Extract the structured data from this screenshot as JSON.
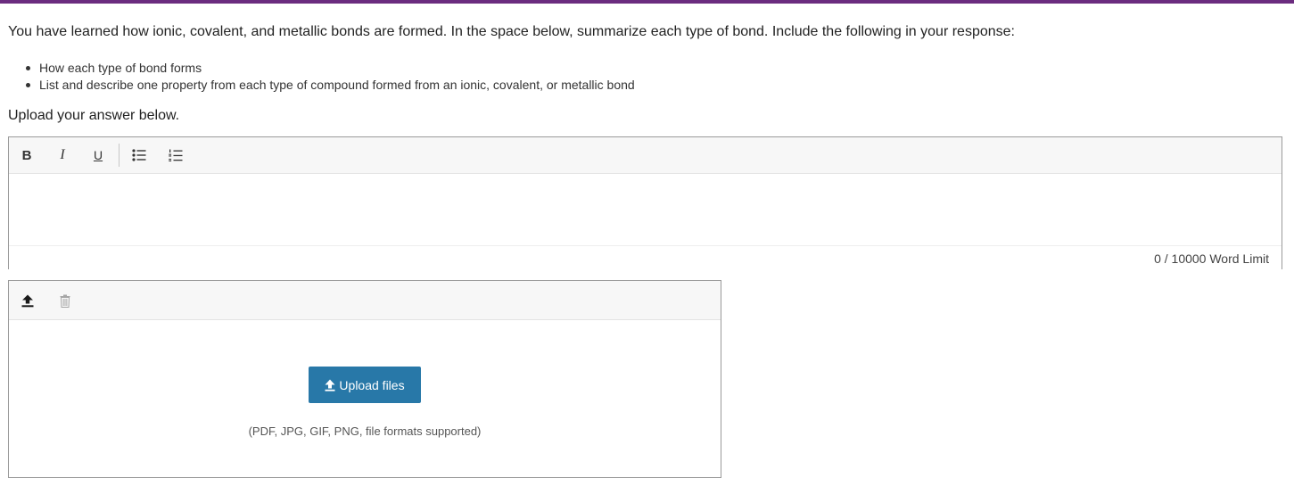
{
  "prompt": "You have learned how ionic, covalent, and metallic bonds are formed. In the space below, summarize each type of bond. Include the following in your response:",
  "bullets": [
    "How each type of bond forms",
    "List and describe one property from each type of compound formed from an ionic, covalent, or metallic bond"
  ],
  "upload_instruction": "Upload your answer below.",
  "editor": {
    "toolbar": {
      "bold_label": "B",
      "italic_label": "I",
      "underline_label": "U",
      "bullet_list_icon": "bulleted-list-icon",
      "numbered_list_icon": "numbered-list-icon"
    },
    "content": "",
    "word_count": "0",
    "word_limit_text": "/ 10000 Word Limit"
  },
  "uploader": {
    "toolbar_icons": [
      "upload-icon",
      "trash-icon"
    ],
    "button_label": "Upload files",
    "formats_text": "(PDF, JPG, GIF, PNG, file formats supported)"
  },
  "colors": {
    "accent_bar": "#6b2c7f",
    "upload_button": "#2878a8"
  }
}
